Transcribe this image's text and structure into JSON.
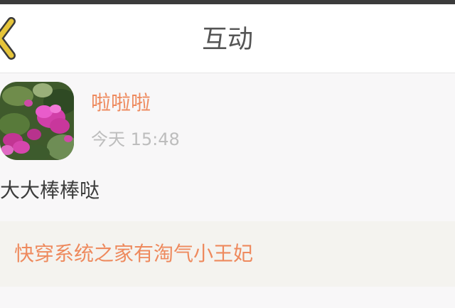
{
  "header": {
    "title": "互动",
    "back_icon": "chevron-left-icon",
    "accent_color": "#e5c43a"
  },
  "post": {
    "username": "啦啦啦",
    "timestamp": "今天 15:48",
    "message": "大大棒棒哒",
    "avatar_icon": "pink-flowers-avatar"
  },
  "book_link": {
    "title": "快穿系统之家有淘气小王妃",
    "color": "#ee8a5e"
  }
}
